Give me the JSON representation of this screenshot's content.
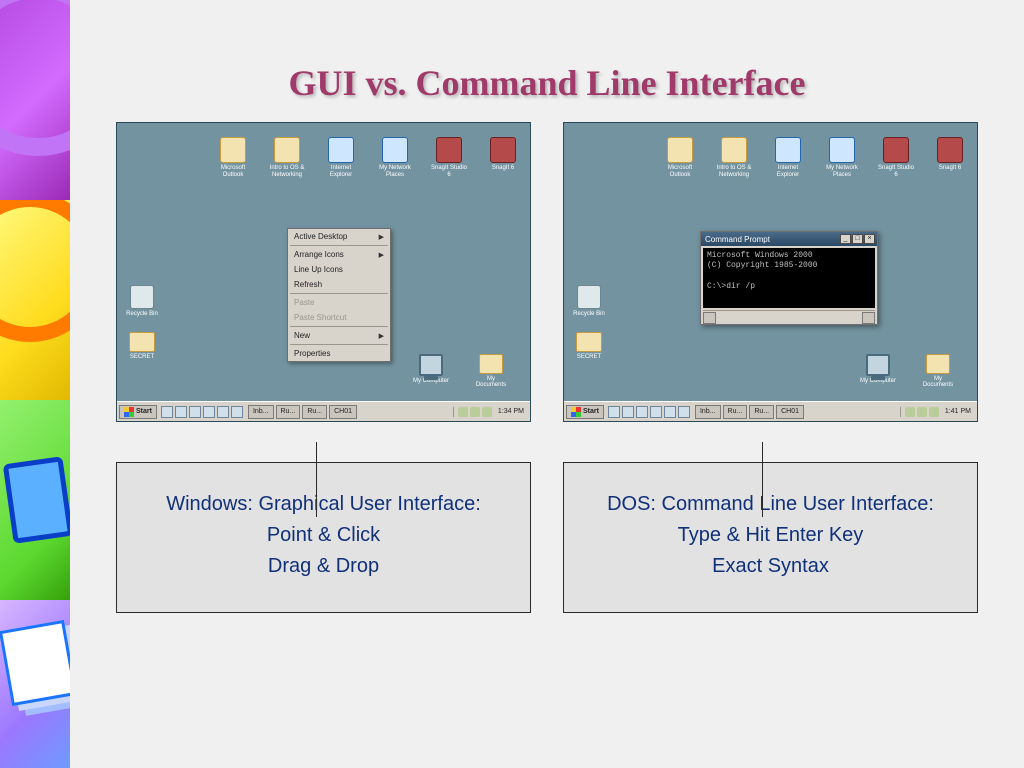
{
  "title": "GUI vs. Command Line Interface",
  "desktop_icons": [
    {
      "glyph_class": "glyph-outlook",
      "label": "Microsoft Outlook"
    },
    {
      "glyph_class": "glyph-folder",
      "label": "Intro to OS & Networking"
    },
    {
      "glyph_class": "glyph-ie",
      "label": "Internet Explorer"
    },
    {
      "glyph_class": "glyph-net",
      "label": "My Network Places"
    },
    {
      "glyph_class": "glyph-snag",
      "label": "SnagIt Studio 6"
    },
    {
      "glyph_class": "glyph-snag",
      "label": "SnagIt 6"
    }
  ],
  "left_icons": {
    "recycle": "Recycle Bin",
    "secret": "SECRET"
  },
  "br_icons": {
    "computer": "My Computer",
    "documents": "My Documents"
  },
  "gui": {
    "context_menu": {
      "items1": [
        {
          "label": "Active Desktop",
          "arrow": true
        }
      ],
      "items2": [
        {
          "label": "Arrange Icons",
          "arrow": true
        },
        {
          "label": "Line Up Icons",
          "arrow": false
        },
        {
          "label": "Refresh",
          "arrow": false
        }
      ],
      "items3": [
        {
          "label": "Paste",
          "disabled": true
        },
        {
          "label": "Paste Shortcut",
          "disabled": true
        }
      ],
      "items4": [
        {
          "label": "New",
          "arrow": true
        }
      ],
      "items5": [
        {
          "label": "Properties"
        }
      ]
    },
    "taskbar": {
      "start": "Start",
      "items": [
        "Inb...",
        "Ru...",
        "Ru...",
        "CH01"
      ],
      "clock": "1:34 PM"
    }
  },
  "cli": {
    "window_title": "Command Prompt",
    "body": "Microsoft Windows 2000\n(C) Copyright 1985-2000\n\nC:\\>dir /p",
    "taskbar": {
      "start": "Start",
      "items": [
        "Inb...",
        "Ru...",
        "Ru...",
        "CH01"
      ],
      "clock": "1:41 PM"
    }
  },
  "captions": {
    "gui": {
      "line1": "Windows: Graphical User Interface:",
      "line2": "Point & Click",
      "line3": "Drag & Drop"
    },
    "cli": {
      "line1": "DOS: Command Line User Interface:",
      "line2": "Type & Hit Enter Key",
      "line3": "Exact Syntax"
    }
  }
}
